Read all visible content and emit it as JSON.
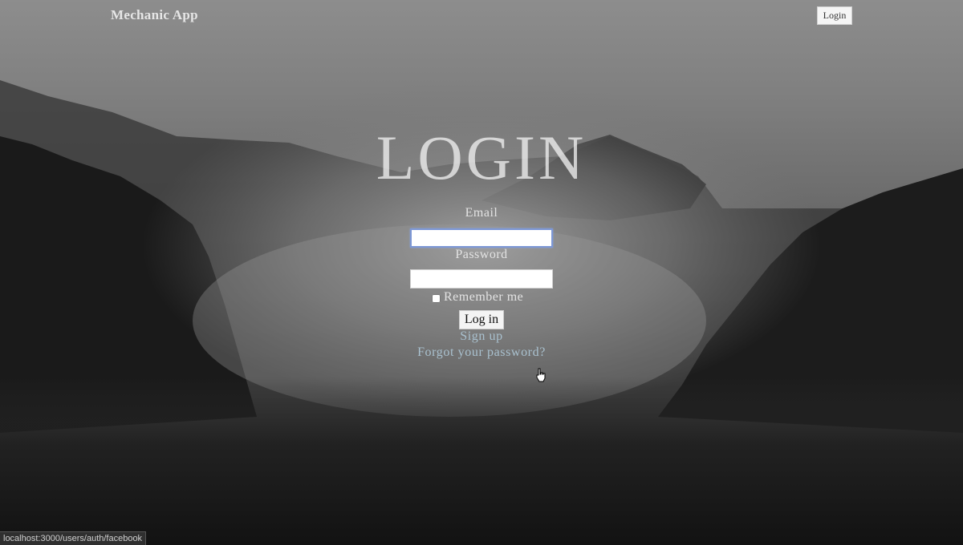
{
  "header": {
    "brand": "Mechanic App",
    "login_link": "Login"
  },
  "form": {
    "title": "LOGIN",
    "email_label": "Email",
    "email_value": "",
    "password_label": "Password",
    "password_value": "",
    "remember_label": "Remember me",
    "remember_checked": false,
    "submit_label": "Log in",
    "signup_link": "Sign up",
    "forgot_link": "Forgot your password?"
  },
  "status_bar": {
    "url": "localhost:3000/users/auth/facebook"
  }
}
